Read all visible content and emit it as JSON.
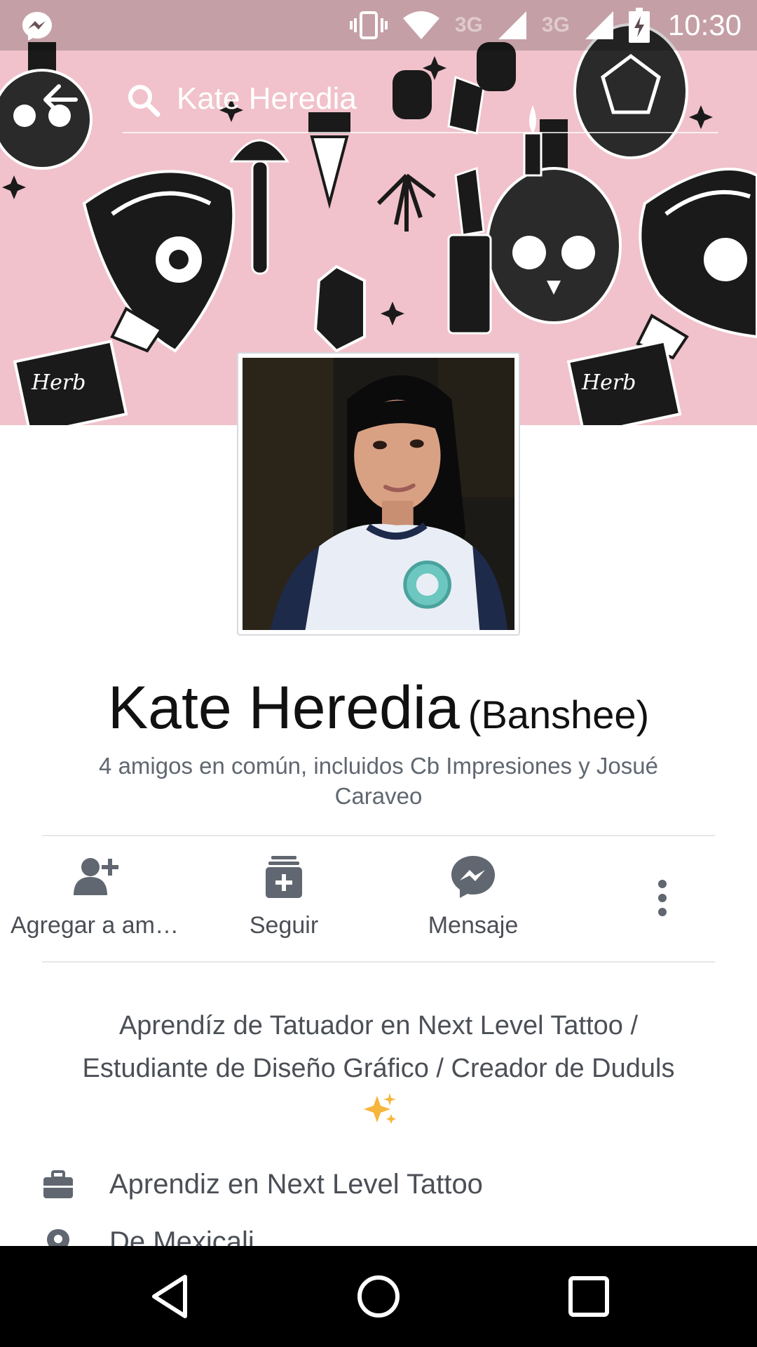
{
  "status_bar": {
    "network_1": "3G",
    "network_2": "3G",
    "time": "10:30",
    "icons": [
      "messenger-icon",
      "vibrate-icon",
      "wifi-icon",
      "signal-icon",
      "signal-icon",
      "battery-charging-icon"
    ]
  },
  "header": {
    "search_value": "Kate Heredia",
    "icons": [
      "back-arrow-icon",
      "search-icon"
    ]
  },
  "profile": {
    "name": "Kate Heredia",
    "alternate_name": "(Banshee)",
    "mutual_friends": "4 amigos en común, incluidos Cb Impresiones y Josué Caraveo"
  },
  "actions": [
    {
      "label": "Agregar a am…",
      "icon": "add-friend-icon"
    },
    {
      "label": "Seguir",
      "icon": "follow-icon"
    },
    {
      "label": "Mensaje",
      "icon": "messenger-icon"
    },
    {
      "label": "",
      "icon": "more-vertical-icon"
    }
  ],
  "bio": {
    "text": "Aprendíz de Tatuador en Next Level Tattoo / Estudiante de Diseño Gráfico / Creador de Duduls",
    "emoji": "sparkles-icon"
  },
  "intro": [
    {
      "icon": "briefcase-icon",
      "text": "Aprendiz en Next Level Tattoo"
    },
    {
      "icon": "location-pin-icon",
      "text": "De Mexicali"
    }
  ],
  "nav_bar": {
    "icons": [
      "back-triangle-icon",
      "home-circle-icon",
      "recents-square-icon"
    ]
  },
  "colors": {
    "cover_background": "#f1c2cb",
    "text_primary": "#111111",
    "text_secondary": "#606770",
    "icon_gray": "#606770",
    "divider": "#e6e7ea"
  }
}
